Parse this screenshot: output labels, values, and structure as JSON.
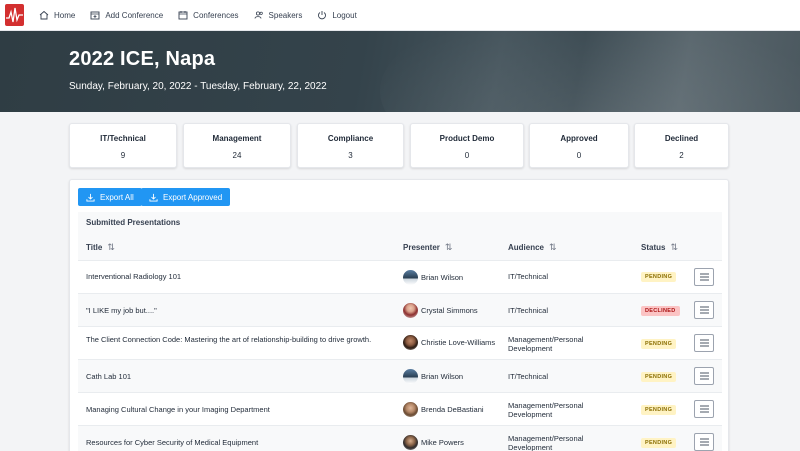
{
  "nav": {
    "items": [
      {
        "label": "Home",
        "icon": "home-icon"
      },
      {
        "label": "Add Conference",
        "icon": "calendar-plus-icon"
      },
      {
        "label": "Conferences",
        "icon": "calendar-icon"
      },
      {
        "label": "Speakers",
        "icon": "users-icon"
      },
      {
        "label": "Logout",
        "icon": "power-icon"
      }
    ]
  },
  "hero": {
    "title": "2022 ICE, Napa",
    "dates": "Sunday, February, 20, 2022 - Tuesday, February, 22, 2022"
  },
  "stats": [
    {
      "label": "IT/Technical",
      "value": "9"
    },
    {
      "label": "Management",
      "value": "24"
    },
    {
      "label": "Compliance",
      "value": "3"
    },
    {
      "label": "Product Demo",
      "value": "0"
    },
    {
      "label": "Approved",
      "value": "0"
    },
    {
      "label": "Declined",
      "value": "2"
    }
  ],
  "actions": {
    "export_all": "Export All",
    "export_approved": "Export Approved"
  },
  "table": {
    "caption": "Submitted Presentations",
    "columns": [
      "Title",
      "Presenter",
      "Audience",
      "Status"
    ],
    "sort_glyph": "⇅",
    "rows": [
      {
        "title": "Interventional Radiology 101",
        "presenter": "Brian Wilson",
        "audience": "IT/Technical",
        "status": "PENDING"
      },
      {
        "title": "\"I LIKE my job but....\"",
        "presenter": "Crystal Simmons",
        "audience": "IT/Technical",
        "status": "DECLINED"
      },
      {
        "title": "The Client Connection Code: Mastering the art of relationship-building to drive growth.",
        "presenter": "Christie Love-Williams",
        "audience": "Management/Personal Development",
        "status": "PENDING"
      },
      {
        "title": "Cath Lab 101",
        "presenter": "Brian Wilson",
        "audience": "IT/Technical",
        "status": "PENDING"
      },
      {
        "title": "Managing Cultural Change in your Imaging Department",
        "presenter": "Brenda DeBastiani",
        "audience": "Management/Personal Development",
        "status": "PENDING"
      },
      {
        "title": "Resources for Cyber Security of Medical Equipment",
        "presenter": "Mike Powers",
        "audience": "Management/Personal Development",
        "status": "PENDING"
      }
    ]
  },
  "colors": {
    "accent": "#2196f3",
    "pending_bg": "#fff3c4",
    "declined_bg": "#fbc4c4",
    "logo": "#d32f2f"
  }
}
